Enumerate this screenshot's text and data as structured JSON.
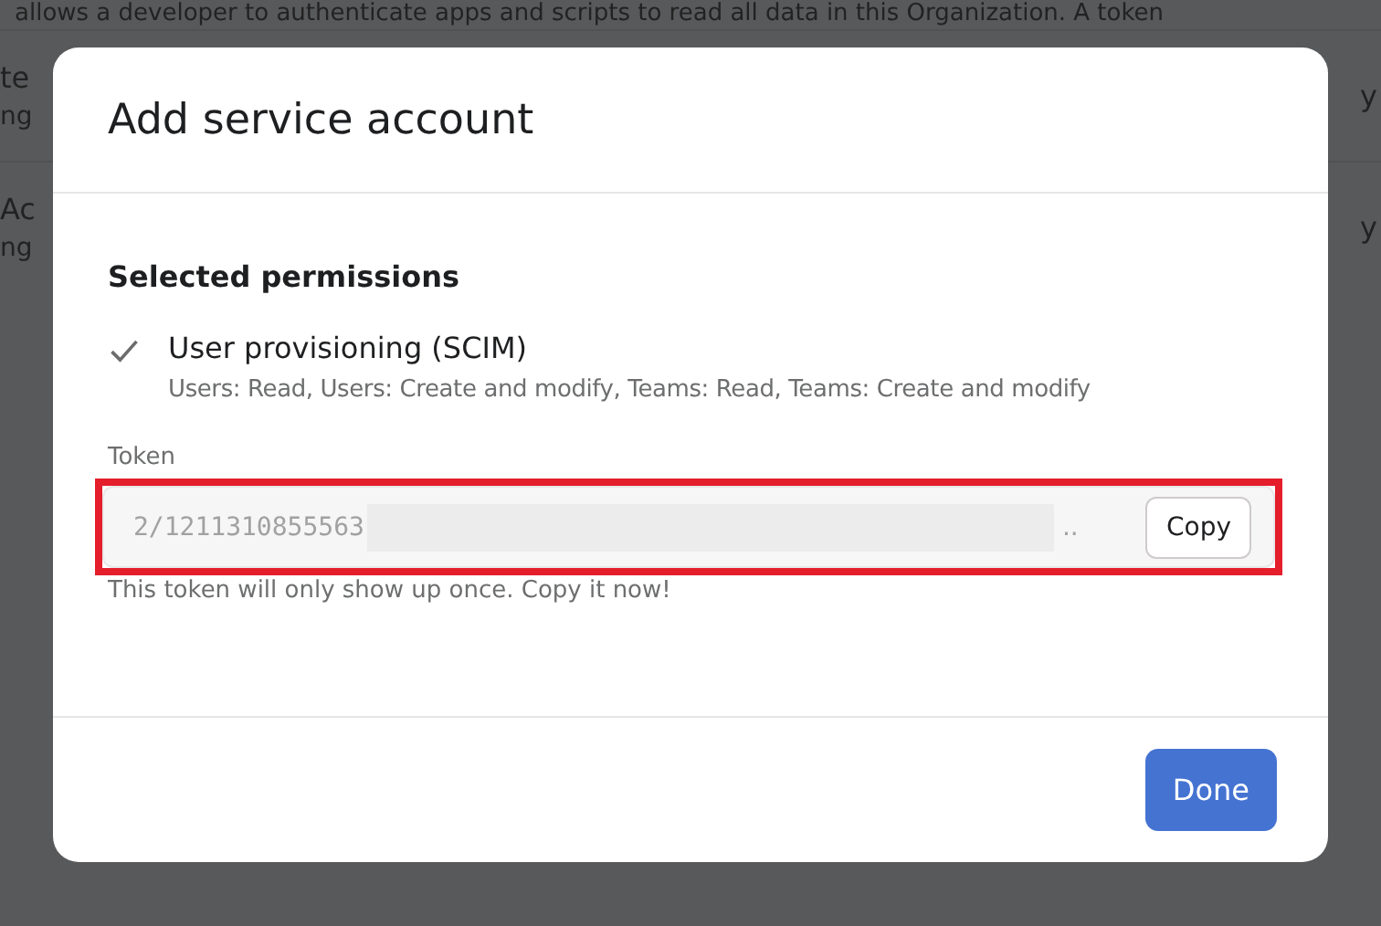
{
  "background": {
    "intro": "allows a developer to authenticate apps and scripts to read all data in this Organization. A token",
    "rows": [
      {
        "name": "te",
        "detail": "ng",
        "action": "y"
      },
      {
        "name": "Ac",
        "detail": "ng",
        "action": "y"
      }
    ]
  },
  "dialog": {
    "title": "Add service account",
    "section_title": "Selected permissions",
    "permissions": [
      {
        "checked": true,
        "name": "User provisioning (SCIM)",
        "scopes": "Users: Read, Users: Create and modify, Teams: Read, Teams: Create and modify"
      }
    ],
    "token": {
      "label": "Token",
      "value": "2/1211310855563",
      "redacted": true,
      "tail": "..",
      "highlighted": true,
      "copy_button": "Copy",
      "hint": "This token will only show up once. Copy it now!"
    },
    "done_button": "Done"
  }
}
